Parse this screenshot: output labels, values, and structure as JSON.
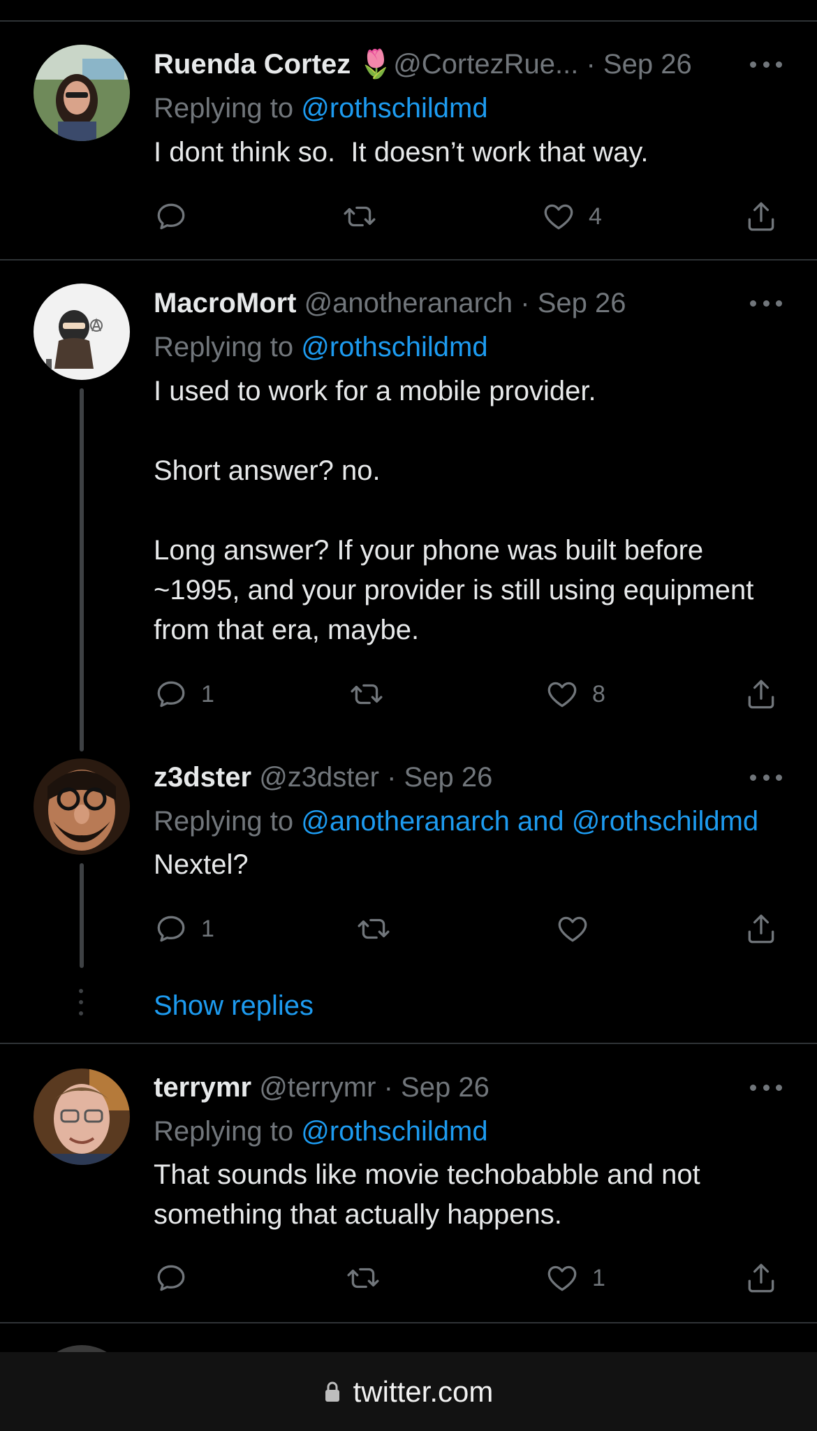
{
  "tweets": [
    {
      "name": "Ruenda Cortez",
      "handle": "@CortezRue...",
      "date": "Sep 26",
      "replying_prefix": "Replying to",
      "replying_to": "@rothschildmd",
      "text": "I dont think so.  It doesn’t work that way.",
      "reply_count": "",
      "retweet_count": "",
      "like_count": "4"
    },
    {
      "name": "MacroMort",
      "handle": "@anotheranarch",
      "date": "Sep 26",
      "replying_prefix": "Replying to",
      "replying_to": "@rothschildmd",
      "text": "I used to work for a mobile provider.\n\nShort answer? no.\n\nLong answer? If your phone was built before ~1995, and your provider is still using equipment from that era, maybe.",
      "reply_count": "1",
      "retweet_count": "",
      "like_count": "8"
    },
    {
      "name": "z3dster",
      "handle": "@z3dster",
      "date": "Sep 26",
      "replying_prefix": "Replying to",
      "replying_to": "@anotheranarch and @rothschildmd",
      "text": "Nextel?",
      "reply_count": "1",
      "retweet_count": "",
      "like_count": ""
    },
    {
      "name": "terrymr",
      "handle": "@terrymr",
      "date": "Sep 26",
      "replying_prefix": "Replying to",
      "replying_to": "@rothschildmd",
      "text": "That sounds like movie techobabble and not something that actually happens.",
      "reply_count": "",
      "retweet_count": "",
      "like_count": "1"
    }
  ],
  "show_replies_label": "Show replies",
  "separator": "·",
  "browser": {
    "url": "twitter.com"
  },
  "colors": {
    "background": "#000000",
    "link": "#1d9bf0",
    "muted": "#71767b",
    "text": "#e7e9ea"
  },
  "icons": [
    "reply-icon",
    "retweet-icon",
    "like-icon",
    "share-icon",
    "more-icon",
    "lock-icon"
  ]
}
